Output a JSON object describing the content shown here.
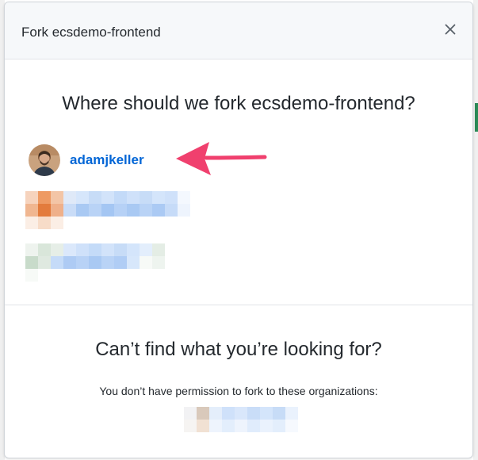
{
  "dialog": {
    "title": "Fork ecsdemo-frontend",
    "close_icon": "close-icon",
    "question": "Where should we fork ecsdemo-frontend?",
    "owner": {
      "name": "adamjkeller",
      "avatar_icon": "user-avatar"
    },
    "annotation": {
      "icon": "pointing-arrow-icon",
      "color": "#f0406e"
    },
    "footer": {
      "heading": "Can’t find what you’re looking for?",
      "note": "You don’t have permission to fork to these organizations:"
    }
  },
  "colors": {
    "link": "#0366d6",
    "header_bg": "#f6f8fa",
    "border": "#e1e4e8",
    "text": "#24292e"
  }
}
